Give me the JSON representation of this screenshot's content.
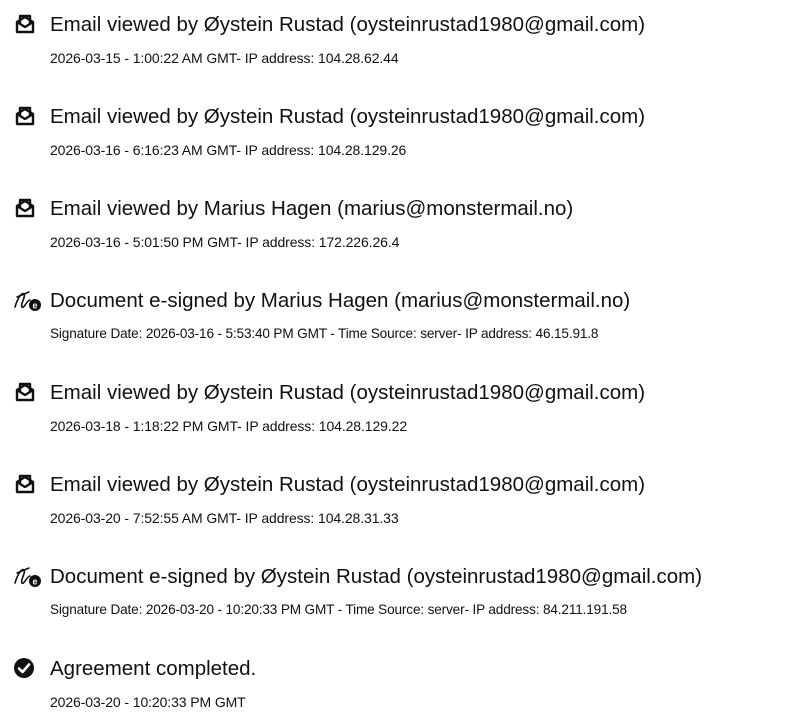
{
  "audit_trail": {
    "events": [
      {
        "icon": "envelope-open-icon",
        "title": "Email viewed by Øystein Rustad (oysteinrustad1980@gmail.com)",
        "meta": "2026-03-15 - 1:00:22 AM GMT- IP address: 104.28.62.44"
      },
      {
        "icon": "envelope-open-icon",
        "title": "Email viewed by Øystein Rustad (oysteinrustad1980@gmail.com)",
        "meta": "2026-03-16 - 6:16:23 AM GMT- IP address: 104.28.129.26"
      },
      {
        "icon": "envelope-open-icon",
        "title": "Email viewed by Marius Hagen (marius@monstermail.no)",
        "meta": "2026-03-16 - 5:01:50 PM GMT- IP address: 172.226.26.4"
      },
      {
        "icon": "e-signature-icon",
        "title": "Document e-signed by Marius Hagen (marius@monstermail.no)",
        "meta": "Signature Date: 2026-03-16 - 5:53:40 PM GMT - Time Source: server- IP address: 46.15.91.8"
      },
      {
        "icon": "envelope-open-icon",
        "title": "Email viewed by Øystein Rustad (oysteinrustad1980@gmail.com)",
        "meta": "2026-03-18 - 1:18:22 PM GMT- IP address: 104.28.129.22"
      },
      {
        "icon": "envelope-open-icon",
        "title": "Email viewed by Øystein Rustad (oysteinrustad1980@gmail.com)",
        "meta": "2026-03-20 - 7:52:55 AM GMT- IP address: 104.28.31.33"
      },
      {
        "icon": "e-signature-icon",
        "title": "Document e-signed by Øystein Rustad (oysteinrustad1980@gmail.com)",
        "meta": "Signature Date: 2026-03-20 - 10:20:33 PM GMT - Time Source: server- IP address: 84.211.191.58"
      },
      {
        "icon": "check-circle-icon",
        "title": "Agreement completed.",
        "meta": "2026-03-20 - 10:20:33 PM GMT"
      }
    ]
  }
}
